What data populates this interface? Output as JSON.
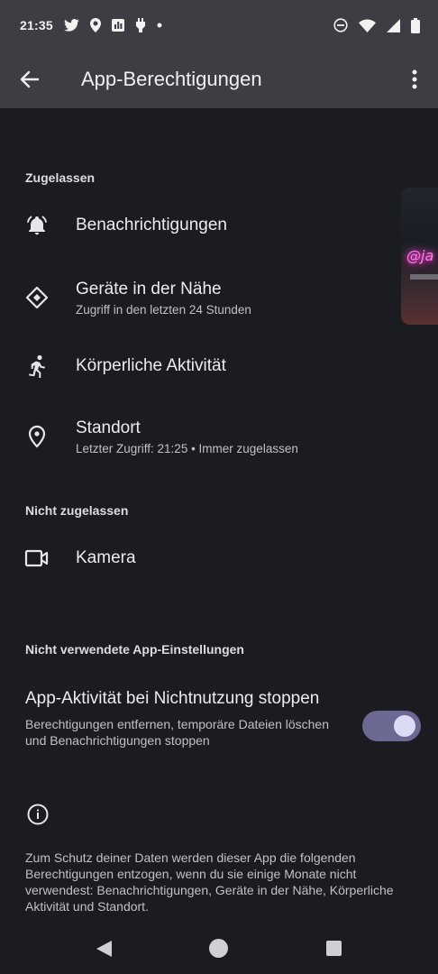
{
  "status_bar": {
    "time": "21:35",
    "left_icons": [
      "twitter-icon",
      "location-icon",
      "chart-icon",
      "plug-icon",
      "dot-icon"
    ],
    "right_icons": [
      "dnd-icon",
      "wifi-icon",
      "signal-icon",
      "battery-icon"
    ]
  },
  "app_bar": {
    "title": "App-Berechtigungen",
    "back_icon": "back-arrow-icon",
    "menu_icon": "more-vert-icon"
  },
  "sections": {
    "allowed_header": "Zugelassen",
    "denied_header": "Nicht zugelassen",
    "unused_header": "Nicht verwendete App-Einstellungen"
  },
  "permissions": {
    "notifications": {
      "title": "Benachrichtigungen",
      "icon": "bell-icon"
    },
    "nearby": {
      "title": "Geräte in der Nähe",
      "subtitle": "Zugriff in den letzten 24 Stunden",
      "icon": "nearby-devices-icon"
    },
    "activity": {
      "title": "Körperliche Aktivität",
      "icon": "running-person-icon"
    },
    "location": {
      "title": "Standort",
      "subtitle": "Letzter Zugriff: 21:25 • Immer zugelassen",
      "icon": "location-pin-icon"
    },
    "camera": {
      "title": "Kamera",
      "icon": "videocam-icon"
    }
  },
  "unused_setting": {
    "title": "App-Aktivität bei Nichtnutzung stoppen",
    "subtitle": "Berechtigungen entfernen, temporäre Dateien löschen und Benachrichtigungen stoppen",
    "toggle_on": true,
    "accent": "#6b6891"
  },
  "info": {
    "icon": "info-icon",
    "text": "Zum Schutz deiner Daten werden dieser App die folgenden Berechtigungen entzogen, wenn du sie einige Monate nicht verwendest: Benachrichtigungen, Geräte in der Nähe, Körperliche Aktivität und Standort."
  },
  "nav_bar": {
    "back": "nav-back-icon",
    "home": "nav-home-icon",
    "recents": "nav-recents-icon"
  }
}
